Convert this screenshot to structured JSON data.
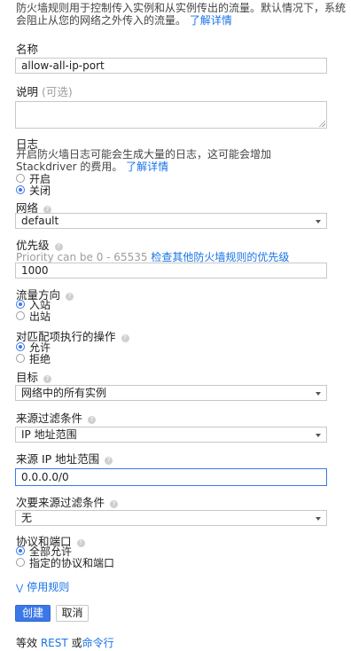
{
  "intro": {
    "text": "防火墙规则用于控制传入实例和从实例传出的流量。默认情况下，系统会阻止从您的网络之外传入的流量。",
    "learn_more": "了解详情"
  },
  "name": {
    "label": "名称",
    "value": "allow-all-ip-port"
  },
  "description": {
    "label": "说明",
    "optional": "(可选)",
    "value": ""
  },
  "logs": {
    "label": "日志",
    "desc": "开启防火墙日志可能会生成大量的日志，这可能会增加 Stackdriver 的费用。",
    "learn_more": "了解详情",
    "options": [
      "开启",
      "关闭"
    ],
    "selected_index": 1
  },
  "network": {
    "label": "网络",
    "value": "default"
  },
  "priority": {
    "label": "优先级",
    "hint": "Priority can be 0 - 65535",
    "hint_link": "检查其他防火墙规则的优先级",
    "value": "1000"
  },
  "direction": {
    "label": "流量方向",
    "options": [
      "入站",
      "出站"
    ],
    "selected_index": 0
  },
  "action": {
    "label": "对匹配项执行的操作",
    "options": [
      "允许",
      "拒绝"
    ],
    "selected_index": 0
  },
  "target": {
    "label": "目标",
    "value": "网络中的所有实例"
  },
  "source_filter": {
    "label": "来源过滤条件",
    "value": "IP 地址范围"
  },
  "source_ip": {
    "label": "来源 IP 地址范围",
    "value": "0.0.0.0/0"
  },
  "second_filter": {
    "label": "次要来源过滤条件",
    "value": "无"
  },
  "protocols": {
    "label": "协议和端口",
    "options": [
      "全部允许",
      "指定的协议和端口"
    ],
    "selected_index": 0
  },
  "disable_rule": "停用规则",
  "buttons": {
    "create": "创建",
    "cancel": "取消"
  },
  "equivalent": {
    "prefix": "等效",
    "rest": "REST",
    "or": "或",
    "cli": "命令行"
  },
  "colors": {
    "accent": "#3b78e7",
    "link": "#1a73e8"
  },
  "icons": {
    "help": "help-icon",
    "dropdown": "chevron-down-icon",
    "expand": "double-chevron-down-icon"
  }
}
